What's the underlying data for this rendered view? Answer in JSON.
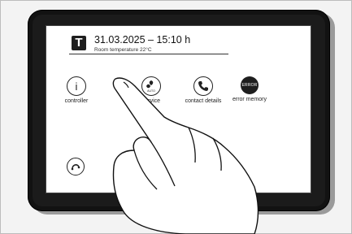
{
  "header": {
    "logo_letter": "T",
    "datetime": "31.03.2025 – 15:10 h",
    "room_temperature": "Room temperature 22°C"
  },
  "menu": {
    "items": [
      {
        "label": "controller",
        "icon": "info-icon",
        "glyph": "i"
      },
      {
        "label": "service",
        "icon": "fan-auto-icon",
        "badge": "AUTO"
      },
      {
        "label": "contact details",
        "icon": "phone-icon"
      },
      {
        "label": "error memory",
        "icon": "error-icon",
        "badge": "ERROR"
      }
    ]
  },
  "footer": {
    "back_icon": "back-arrow-icon"
  }
}
